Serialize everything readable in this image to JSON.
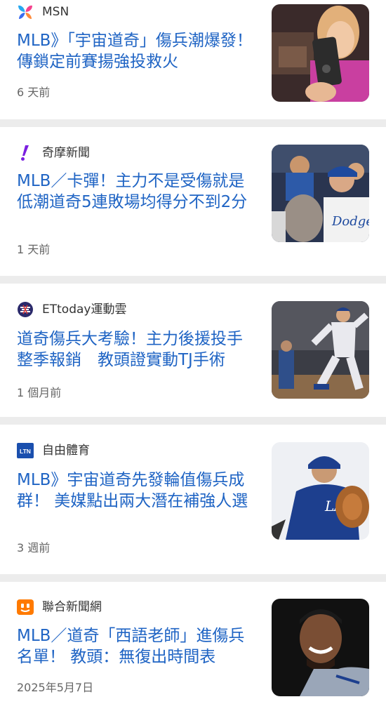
{
  "articles": [
    {
      "source": "MSN",
      "source_icon": "msn-butterfly-icon",
      "headline": "MLB》「宇宙道奇」傷兵潮爆發！ 傳鎖定前賽揚強投救火",
      "time": "6 天前",
      "thumbnail": "woman-holding-device-image"
    },
    {
      "source": "奇摩新聞",
      "source_icon": "yahoo-exclamation-icon",
      "headline": "MLB／卡彈！主力不是受傷就是低潮道奇5連敗場均得分不到2分",
      "time": "1 天前",
      "thumbnail": "dodgers-players-dugout-image"
    },
    {
      "source": "ETtoday運動雲",
      "source_icon": "ettoday-sports-icon",
      "headline": "道奇傷兵大考驗！主力後援投手整季報銷　教頭證實動TJ手術",
      "time": "1 個月前",
      "thumbnail": "pitcher-throwing-image"
    },
    {
      "source": "自由體育",
      "source_icon": "ltn-logo-icon",
      "source_icon_text": "LTN",
      "headline": "MLB》宇宙道奇先發輪值傷兵成群！ 美媒點出兩大潛在補強人選",
      "time": "3 週前",
      "thumbnail": "pitcher-with-glove-image"
    },
    {
      "source": "聯合新聞網",
      "source_icon": "udn-logo-icon",
      "headline": "MLB／道奇「西語老師」進傷兵名單！ 教頭：無復出時間表",
      "time": "2025年5月7日",
      "thumbnail": "smiling-player-image"
    }
  ],
  "colors": {
    "headline": "#1f64c4",
    "source": "#333333",
    "time": "#666666",
    "separator": "#ececec"
  }
}
